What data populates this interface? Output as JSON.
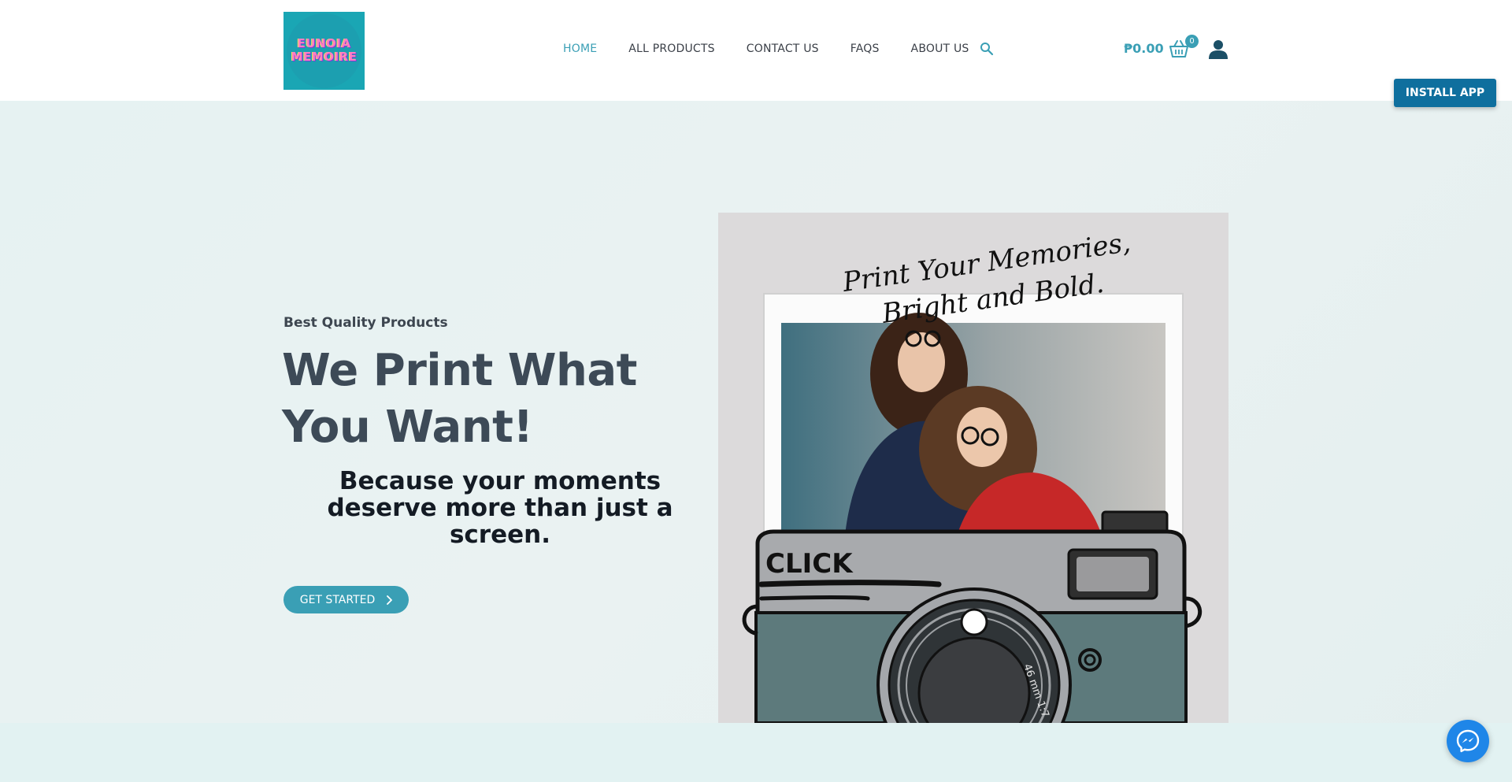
{
  "brand": {
    "logo_line1": "EUNOIA",
    "logo_line2": "MEMOIRE"
  },
  "nav": {
    "items": [
      {
        "label": "HOME",
        "active": true
      },
      {
        "label": "ALL PRODUCTS",
        "active": false
      },
      {
        "label": "CONTACT US",
        "active": false
      },
      {
        "label": "FAQS",
        "active": false
      },
      {
        "label": "ABOUT US",
        "active": false
      }
    ],
    "search_icon": "search-icon"
  },
  "cart": {
    "total": "₱0.00",
    "count": "0",
    "icon": "basket-icon"
  },
  "account": {
    "icon": "user-icon"
  },
  "install_app": {
    "label": "INSTALL APP"
  },
  "hero": {
    "eyebrow": "Best Quality Products",
    "headline": "We Print What You Want!",
    "subheadline": "Because your moments deserve more than just a screen.",
    "cta_label": "GET STARTED",
    "image": {
      "script_line1": "Print Your Memories,",
      "script_line2": "Bright and Bold.",
      "camera_label": "CLICK",
      "lens_text": "46 mm 1:7"
    }
  },
  "chat": {
    "icon": "messenger-icon"
  },
  "colors": {
    "accent": "#3a9fb5",
    "install_button": "#0f6f9e",
    "heading": "#3d4a57",
    "hero_bg": "#e8f3f3"
  }
}
